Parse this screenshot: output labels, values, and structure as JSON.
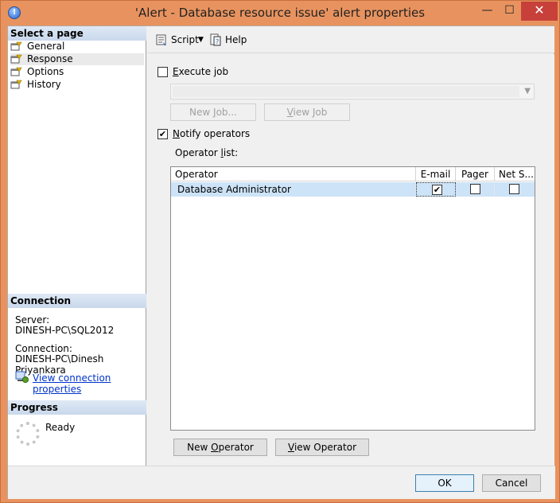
{
  "window": {
    "title": "'Alert - Database resource issue' alert properties",
    "minimize_glyph": "—",
    "maximize_glyph": "☐",
    "close_glyph": "✕",
    "app_icon_glyph": "!"
  },
  "sidebar": {
    "header": "Select a page",
    "items": [
      {
        "label": "General"
      },
      {
        "label": "Response"
      },
      {
        "label": "Options"
      },
      {
        "label": "History"
      }
    ]
  },
  "connection": {
    "header": "Connection",
    "server_label": "Server:",
    "server_value": "DINESH-PC\\SQL2012",
    "connection_label": "Connection:",
    "connection_value": "DINESH-PC\\Dinesh Priyankara",
    "view_link": "View connection properties"
  },
  "progress": {
    "header": "Progress",
    "status": "Ready"
  },
  "toolbar": {
    "script_label": "Script",
    "help_label": "Help"
  },
  "response": {
    "execute_job_prefix": "",
    "execute_job_u": "E",
    "execute_job_rest": "xecute job",
    "execute_job_checked": false,
    "new_job_prefix": "New ",
    "new_job_u": "J",
    "new_job_rest": "ob...",
    "view_job_u": "V",
    "view_job_rest": "iew Job",
    "notify_u": "N",
    "notify_rest": "otify operators",
    "notify_checked": true,
    "operator_list_prefix": "Operator ",
    "operator_list_u": "l",
    "operator_list_rest": "ist:",
    "columns": [
      "Operator",
      "E-mail",
      "Pager",
      "Net S..."
    ],
    "rows": [
      {
        "operator": "Database Administrator",
        "email": true,
        "pager": false,
        "net_send": false
      }
    ],
    "new_operator_prefix": "New ",
    "new_operator_u": "O",
    "new_operator_rest": "perator",
    "view_operator_prefix": "",
    "view_operator_u": "V",
    "view_operator_rest": "iew Operator"
  },
  "footer": {
    "ok_label": "OK",
    "cancel_label": "Cancel"
  }
}
